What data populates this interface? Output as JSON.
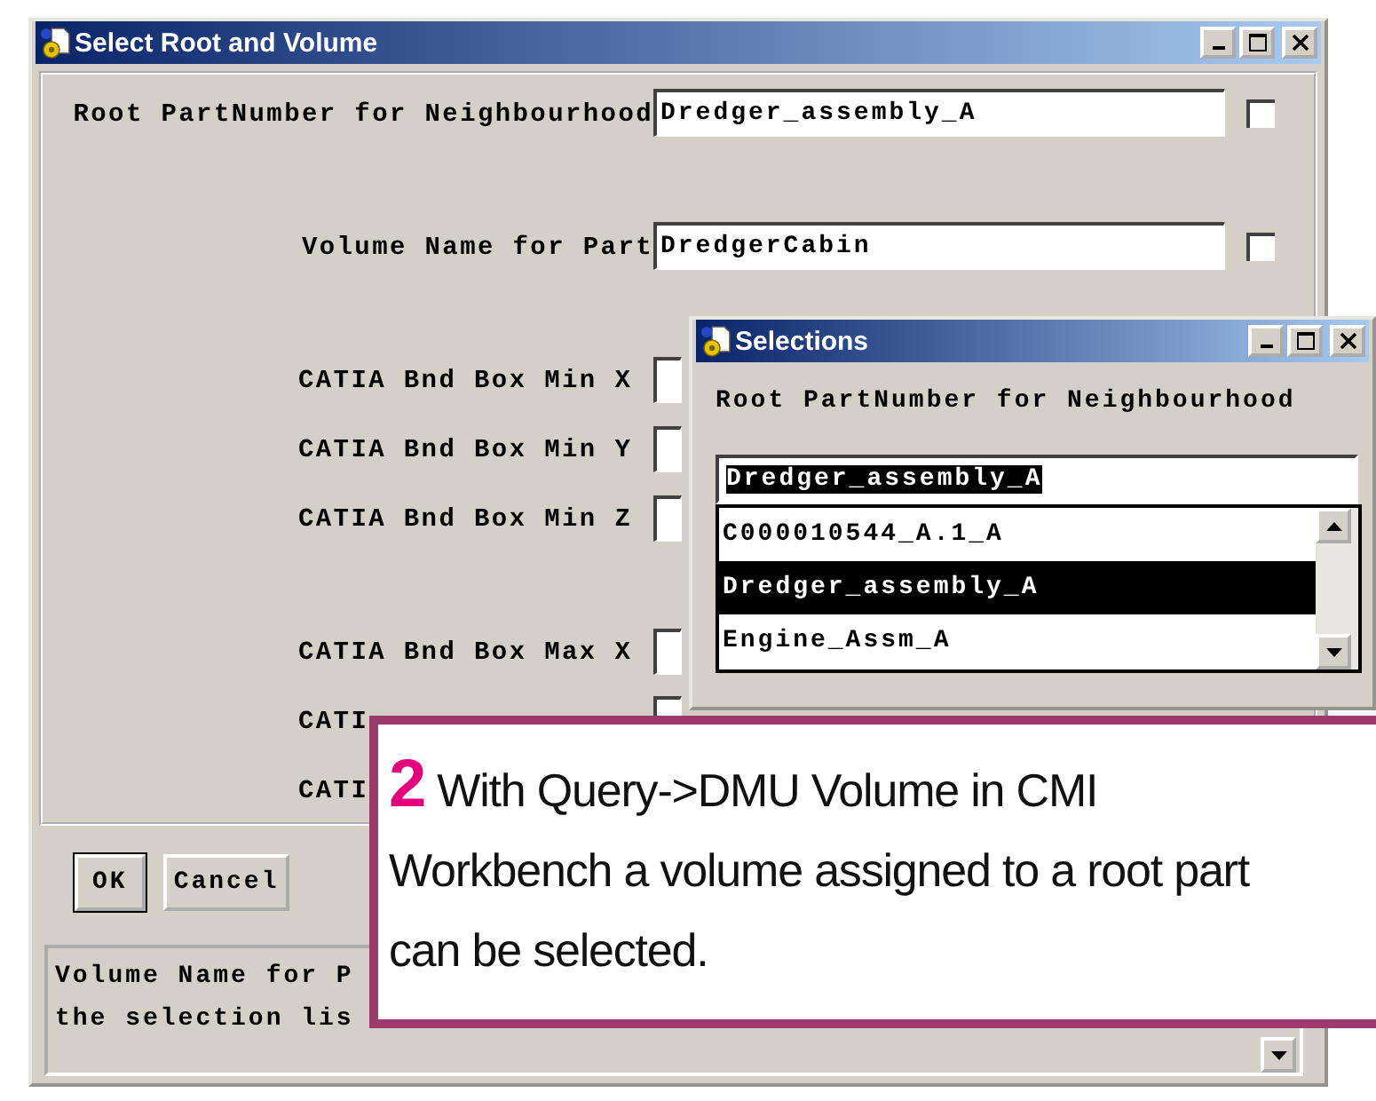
{
  "main_window": {
    "title": "Select Root and Volume",
    "groups": [
      [
        {
          "kind": "wide",
          "label": "Root PartNumber for Neighbourhood",
          "value": "Dredger_assembly_A",
          "checked": false
        }
      ],
      [
        {
          "kind": "wide",
          "label": "Volume Name for Part",
          "value": "DredgerCabin",
          "checked": false
        }
      ],
      [
        {
          "kind": "short",
          "label": "CATIA Bnd Box Min X"
        },
        {
          "kind": "short",
          "label": "CATIA Bnd Box Min Y"
        },
        {
          "kind": "short",
          "label": "CATIA Bnd Box Min Z"
        }
      ],
      [
        {
          "kind": "short",
          "label": "CATIA Bnd Box Max X"
        },
        {
          "kind": "short",
          "label": "CATI"
        },
        {
          "kind": "bare",
          "label": "CATI"
        }
      ]
    ],
    "buttons": [
      {
        "label": "OK",
        "default": true
      },
      {
        "label": "Cancel",
        "default": false
      }
    ],
    "message": [
      "Volume Name for P",
      "the selection lis"
    ]
  },
  "selections_window": {
    "title": "Selections",
    "label": "Root PartNumber for Neighbourhood",
    "value": "Dredger_assembly_A",
    "value_highlighted": true,
    "items": [
      {
        "label": "C000010544_A.1_A",
        "selected": false
      },
      {
        "label": "Dredger_assembly_A",
        "selected": true
      },
      {
        "label": "Engine_Assm_A",
        "selected": false
      }
    ]
  },
  "callout": {
    "number": "2",
    "text": "With Query->DMU Volume in CMI Workbench a volume assigned to a root part can be selected."
  }
}
